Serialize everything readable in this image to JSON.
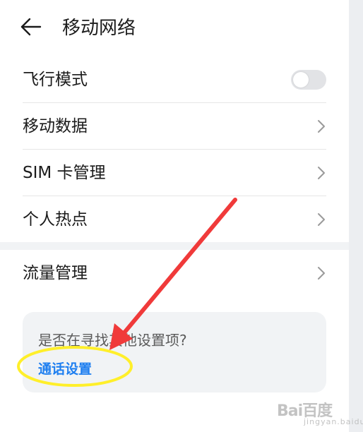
{
  "header": {
    "title": "移动网络",
    "back_icon": "arrow-left-icon"
  },
  "settings": {
    "items": [
      {
        "label": "飞行模式",
        "control": "toggle",
        "toggle_on": false
      },
      {
        "label": "移动数据",
        "control": "chevron"
      },
      {
        "label": "SIM 卡管理",
        "control": "chevron"
      },
      {
        "label": "个人热点",
        "control": "chevron"
      },
      {
        "label": "流量管理",
        "control": "chevron"
      }
    ]
  },
  "suggestion": {
    "question": "是否在寻找其他设置项?",
    "link_label": "通话设置"
  },
  "annotation": {
    "arrow_color": "#f03a3a",
    "ellipse_color": "#ffef2a"
  },
  "watermark": {
    "logo_text": "Bai百度",
    "sub_text": "jingyan.baidu.com"
  },
  "colors": {
    "accent": "#1f7ff0",
    "background": "#f1f3f5",
    "card": "#ffffff"
  }
}
